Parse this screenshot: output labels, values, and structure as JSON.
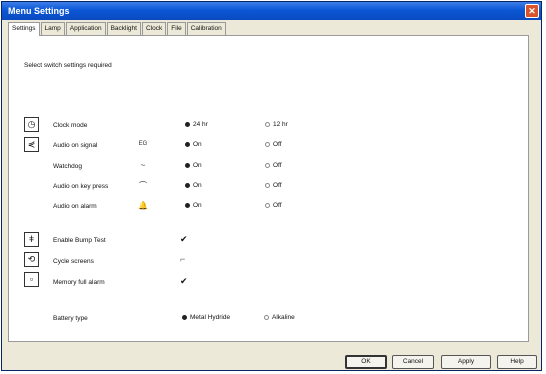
{
  "window": {
    "title": "Menu Settings"
  },
  "tabs": [
    "Settings",
    "Lamp",
    "Application",
    "Backlight",
    "Clock",
    "File",
    "Calibration"
  ],
  "instructions": "Select switch settings required",
  "clock_mode": {
    "label": "Clock mode",
    "option1": "24 hr",
    "option2": "12 hr"
  },
  "radio_rows": [
    {
      "label": "Audio on signal",
      "symbol": "EG",
      "option1": "On",
      "option2": "Off"
    },
    {
      "label": "Watchdog",
      "symbol": "~",
      "option1": "On",
      "option2": "Off"
    },
    {
      "label": "Audio on key press",
      "symbol": "⌒",
      "option1": "On",
      "option2": "Off"
    },
    {
      "label": "Audio on alarm",
      "symbol": "🔔",
      "option1": "On",
      "option2": "Off"
    }
  ],
  "checkboxes": [
    {
      "label": "Enable Bump Test",
      "mark": "✔"
    },
    {
      "label": "Cycle screens",
      "mark": "⌐"
    },
    {
      "label": "Memory full alarm",
      "mark": "✔"
    }
  ],
  "battery": {
    "label": "Battery type",
    "option1": "Metal Hydride",
    "option2": "Alkaline"
  },
  "buttons": {
    "ok": "OK",
    "cancel": "Cancel",
    "apply": "Apply",
    "help": "Help"
  }
}
